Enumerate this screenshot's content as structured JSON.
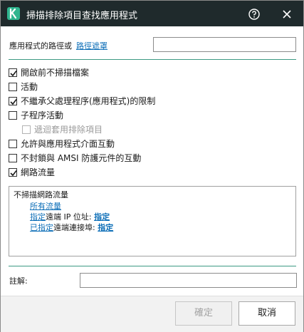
{
  "window": {
    "title": "掃描排除項目查找應用程式"
  },
  "path": {
    "label": "應用程式的路徑或",
    "link": "路徑遮罩",
    "value": ""
  },
  "options": [
    {
      "label": "開啟前不掃描檔案",
      "checked": true,
      "disabled": false
    },
    {
      "label": "活動",
      "checked": false,
      "disabled": false
    },
    {
      "label": "不繼承父處理程序(應用程式)的限制",
      "checked": true,
      "disabled": false
    },
    {
      "label": "子程序活動",
      "checked": false,
      "disabled": false
    },
    {
      "label": "遞迴套用排除項目",
      "checked": false,
      "disabled": true
    },
    {
      "label": "允許與應用程式介面互動",
      "checked": false,
      "disabled": false
    },
    {
      "label": "不封鎖與 AMSI 防護元件的互動",
      "checked": false,
      "disabled": false
    },
    {
      "label": "網路流量",
      "checked": true,
      "disabled": false
    }
  ],
  "traffic": {
    "title": "不掃描網路流量",
    "all_traffic": "所有流量",
    "ip_prefix": "指定",
    "ip_text": "遠端 IP 位址:",
    "ip_value": "指定",
    "port_prefix": "已指定",
    "port_text": "遠端連接埠:",
    "port_value": "指定"
  },
  "comment": {
    "label": "註解:",
    "value": ""
  },
  "buttons": {
    "ok": "確定",
    "cancel": "取消"
  },
  "colors": {
    "titlebar": "#1f2a2c",
    "accent": "#2fb58f",
    "link": "#0e6fb8"
  }
}
